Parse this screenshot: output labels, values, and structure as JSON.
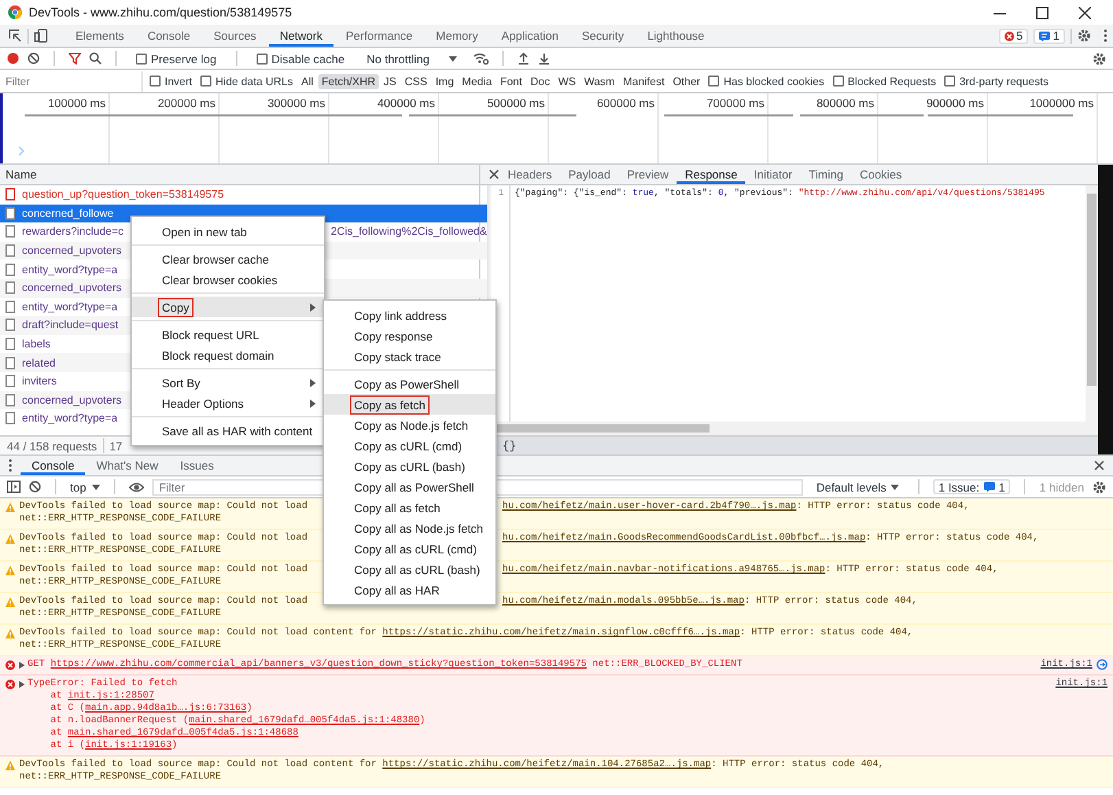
{
  "window": {
    "title": "DevTools - www.zhihu.com/question/538149575"
  },
  "panel_tabs": [
    {
      "label": "Elements",
      "selected": false
    },
    {
      "label": "Console",
      "selected": false
    },
    {
      "label": "Sources",
      "selected": false
    },
    {
      "label": "Network",
      "selected": true
    },
    {
      "label": "Performance",
      "selected": false
    },
    {
      "label": "Memory",
      "selected": false
    },
    {
      "label": "Application",
      "selected": false
    },
    {
      "label": "Security",
      "selected": false
    },
    {
      "label": "Lighthouse",
      "selected": false
    }
  ],
  "badges": {
    "errors": "5",
    "messages": "1"
  },
  "toolbar": {
    "recording": true,
    "preserve_log": {
      "label": "Preserve log",
      "checked": false
    },
    "disable_cache": {
      "label": "Disable cache",
      "checked": false
    },
    "throttling": "No throttling"
  },
  "filter_bar": {
    "placeholder": "Filter",
    "invert": {
      "label": "Invert",
      "checked": false
    },
    "hide_data_urls": {
      "label": "Hide data URLs",
      "checked": false
    },
    "types": [
      {
        "label": "All",
        "selected": false
      },
      {
        "label": "Fetch/XHR",
        "selected": true
      },
      {
        "label": "JS",
        "selected": false
      },
      {
        "label": "CSS",
        "selected": false
      },
      {
        "label": "Img",
        "selected": false
      },
      {
        "label": "Media",
        "selected": false
      },
      {
        "label": "Font",
        "selected": false
      },
      {
        "label": "Doc",
        "selected": false
      },
      {
        "label": "WS",
        "selected": false
      },
      {
        "label": "Wasm",
        "selected": false
      },
      {
        "label": "Manifest",
        "selected": false
      },
      {
        "label": "Other",
        "selected": false
      }
    ],
    "options": [
      {
        "label": "Has blocked cookies",
        "checked": false
      },
      {
        "label": "Blocked Requests",
        "checked": false
      },
      {
        "label": "3rd-party requests",
        "checked": false
      }
    ]
  },
  "timeline": {
    "ticks": [
      "100000 ms",
      "200000 ms",
      "300000 ms",
      "400000 ms",
      "500000 ms",
      "600000 ms",
      "700000 ms",
      "800000 ms",
      "900000 ms",
      "1000000 ms"
    ]
  },
  "requests": {
    "column": "Name",
    "rows": [
      {
        "name": "question_up?question_token=538149575",
        "failed": true,
        "selected": false
      },
      {
        "name": "concerned_followe",
        "failed": false,
        "selected": true
      },
      {
        "name": "rewarders?include=c",
        "tail": "2Cis_following%2Cis_followed&",
        "failed": false,
        "selected": false
      },
      {
        "name": "concerned_upvoters",
        "failed": false,
        "selected": false
      },
      {
        "name": "entity_word?type=a",
        "failed": false,
        "selected": false
      },
      {
        "name": "concerned_upvoters",
        "failed": false,
        "selected": false
      },
      {
        "name": "entity_word?type=a",
        "failed": false,
        "selected": false
      },
      {
        "name": "draft?include=quest",
        "failed": false,
        "selected": false
      },
      {
        "name": "labels",
        "failed": false,
        "selected": false
      },
      {
        "name": "related",
        "failed": false,
        "selected": false
      },
      {
        "name": "inviters",
        "failed": false,
        "selected": false
      },
      {
        "name": "concerned_upvoters",
        "failed": false,
        "selected": false
      },
      {
        "name": "entity_word?type=a",
        "failed": false,
        "selected": false
      }
    ],
    "status": [
      "44 / 158 requests",
      "17"
    ]
  },
  "detail": {
    "tabs": [
      {
        "label": "Headers",
        "selected": false
      },
      {
        "label": "Payload",
        "selected": false
      },
      {
        "label": "Preview",
        "selected": false
      },
      {
        "label": "Response",
        "selected": true
      },
      {
        "label": "Initiator",
        "selected": false
      },
      {
        "label": "Timing",
        "selected": false
      },
      {
        "label": "Cookies",
        "selected": false
      }
    ],
    "lines": [
      {
        "number": "1",
        "tokens": [
          {
            "kind": "punct",
            "text": "{"
          },
          {
            "kind": "key",
            "text": "\"paging\""
          },
          {
            "kind": "punct",
            "text": ": {"
          },
          {
            "kind": "key",
            "text": "\"is_end\""
          },
          {
            "kind": "punct",
            "text": ": "
          },
          {
            "kind": "keyword",
            "text": "true"
          },
          {
            "kind": "punct",
            "text": ", "
          },
          {
            "kind": "key",
            "text": "\"totals\""
          },
          {
            "kind": "punct",
            "text": ": "
          },
          {
            "kind": "number",
            "text": "0"
          },
          {
            "kind": "punct",
            "text": ", "
          },
          {
            "kind": "key",
            "text": "\"previous\""
          },
          {
            "kind": "punct",
            "text": ": "
          },
          {
            "kind": "string",
            "text": "\"http://www.zhihu.com/api/v4/questions/5381495"
          }
        ]
      }
    ],
    "footer": "{}"
  },
  "drawer": {
    "tabs": [
      {
        "label": "Console",
        "selected": true
      },
      {
        "label": "What's New",
        "selected": false
      },
      {
        "label": "Issues",
        "selected": false
      }
    ],
    "context": "top",
    "placeholder": "Filter",
    "levels": "Default levels",
    "issues": "1 Issue:",
    "issues_count": "1",
    "hidden": "1 hidden",
    "messages": [
      {
        "kind": "warning",
        "lines": [
          {
            "left": [
              {
                "kind": "text",
                "text": "DevTools failed to load source map: Could not load"
              }
            ],
            "right": [
              {
                "kind": "link",
                "text": "hu.com/heifetz/main.user-hover-card.2b4f790….js.map"
              },
              {
                "kind": "text",
                "text": ": HTTP error: status code 404,"
              }
            ]
          },
          {
            "left": [
              {
                "kind": "text",
                "text": "net::ERR_HTTP_RESPONSE_CODE_FAILURE"
              }
            ]
          }
        ]
      },
      {
        "kind": "warning",
        "lines": [
          {
            "left": [
              {
                "kind": "text",
                "text": "DevTools failed to load source map: Could not load"
              }
            ],
            "right": [
              {
                "kind": "link",
                "text": "hu.com/heifetz/main.GoodsRecommendGoodsCardList.00bfbcf….js.map"
              },
              {
                "kind": "text",
                "text": ": HTTP error: status code 404,"
              }
            ]
          },
          {
            "left": [
              {
                "kind": "text",
                "text": "net::ERR_HTTP_RESPONSE_CODE_FAILURE"
              }
            ]
          }
        ]
      },
      {
        "kind": "warning",
        "lines": [
          {
            "left": [
              {
                "kind": "text",
                "text": "DevTools failed to load source map: Could not load"
              }
            ],
            "right": [
              {
                "kind": "link",
                "text": "hu.com/heifetz/main.navbar-notifications.a948765….js.map"
              },
              {
                "kind": "text",
                "text": ": HTTP error: status code 404,"
              }
            ]
          },
          {
            "left": [
              {
                "kind": "text",
                "text": "net::ERR_HTTP_RESPONSE_CODE_FAILURE"
              }
            ]
          }
        ]
      },
      {
        "kind": "warning",
        "lines": [
          {
            "left": [
              {
                "kind": "text",
                "text": "DevTools failed to load source map: Could not load"
              }
            ],
            "right": [
              {
                "kind": "link",
                "text": "hu.com/heifetz/main.modals.095bb5e….js.map"
              },
              {
                "kind": "text",
                "text": ": HTTP error: status code 404,"
              }
            ]
          },
          {
            "left": [
              {
                "kind": "text",
                "text": "net::ERR_HTTP_RESPONSE_CODE_FAILURE"
              }
            ]
          }
        ]
      },
      {
        "kind": "warning",
        "lines": [
          {
            "left": [
              {
                "kind": "text",
                "text": "DevTools failed to load source map: Could not load content for "
              },
              {
                "kind": "link",
                "text": "https://static.zhihu.com/heifetz/main.signflow.c0cfff6….js.map"
              },
              {
                "kind": "text",
                "text": ": HTTP error: status code 404,"
              }
            ]
          },
          {
            "left": [
              {
                "kind": "text",
                "text": "net::ERR_HTTP_RESPONSE_CODE_FAILURE"
              }
            ]
          }
        ]
      },
      {
        "kind": "error",
        "expandable": true,
        "source": "init.js:1",
        "lines": [
          {
            "left": [
              {
                "kind": "text",
                "text": "GET "
              },
              {
                "kind": "link",
                "text": "https://www.zhihu.com/commercial_api/banners_v3/question_down_sticky?question_token=538149575"
              },
              {
                "kind": "text",
                "text": " net::ERR_BLOCKED_BY_CLIENT"
              }
            ]
          }
        ]
      },
      {
        "kind": "error",
        "expandable": true,
        "source": "init.js:1",
        "lines": [
          {
            "left": [
              {
                "kind": "text",
                "text": "TypeError: Failed to fetch"
              }
            ]
          },
          {
            "left": [
              {
                "kind": "text",
                "text": "    at "
              },
              {
                "kind": "link",
                "text": "init.js:1:28507"
              }
            ]
          },
          {
            "left": [
              {
                "kind": "text",
                "text": "    at C ("
              },
              {
                "kind": "link",
                "text": "main.app.94d8a1b….js:6:73163"
              },
              {
                "kind": "text",
                "text": ")"
              }
            ]
          },
          {
            "left": [
              {
                "kind": "text",
                "text": "    at n.loadBannerRequest ("
              },
              {
                "kind": "link",
                "text": "main.shared_1679dafd…005f4da5.js:1:48380"
              },
              {
                "kind": "text",
                "text": ")"
              }
            ]
          },
          {
            "left": [
              {
                "kind": "text",
                "text": "    at "
              },
              {
                "kind": "link",
                "text": "main.shared_1679dafd…005f4da5.js:1:48688"
              }
            ]
          },
          {
            "left": [
              {
                "kind": "text",
                "text": "    at i ("
              },
              {
                "kind": "link",
                "text": "init.js:1:19163"
              },
              {
                "kind": "text",
                "text": ")"
              }
            ]
          }
        ]
      },
      {
        "kind": "warning",
        "lines": [
          {
            "left": [
              {
                "kind": "text",
                "text": "DevTools failed to load source map: Could not load content for "
              },
              {
                "kind": "link",
                "text": "https://static.zhihu.com/heifetz/main.104.27685a2….js.map"
              },
              {
                "kind": "text",
                "text": ": HTTP error: status code 404,"
              }
            ]
          },
          {
            "left": [
              {
                "kind": "text",
                "text": "net::ERR_HTTP_RESPONSE_CODE_FAILURE"
              }
            ]
          }
        ]
      }
    ]
  },
  "context_menu": {
    "items": [
      {
        "kind": "item",
        "label": "Open in new tab",
        "submenu": false,
        "highlighted": false,
        "boxed": false
      },
      {
        "kind": "separator"
      },
      {
        "kind": "item",
        "label": "Clear browser cache",
        "submenu": false,
        "highlighted": false,
        "boxed": false
      },
      {
        "kind": "item",
        "label": "Clear browser cookies",
        "submenu": false,
        "highlighted": false,
        "boxed": false
      },
      {
        "kind": "separator"
      },
      {
        "kind": "item",
        "label": "Copy",
        "submenu": true,
        "highlighted": true,
        "boxed": true
      },
      {
        "kind": "separator"
      },
      {
        "kind": "item",
        "label": "Block request URL",
        "submenu": false,
        "highlighted": false,
        "boxed": false
      },
      {
        "kind": "item",
        "label": "Block request domain",
        "submenu": false,
        "highlighted": false,
        "boxed": false
      },
      {
        "kind": "separator"
      },
      {
        "kind": "item",
        "label": "Sort By",
        "submenu": true,
        "highlighted": false,
        "boxed": false
      },
      {
        "kind": "item",
        "label": "Header Options",
        "submenu": true,
        "highlighted": false,
        "boxed": false
      },
      {
        "kind": "separator"
      },
      {
        "kind": "item",
        "label": "Save all as HAR with content",
        "submenu": false,
        "highlighted": false,
        "boxed": false
      }
    ]
  },
  "submenu": {
    "items": [
      {
        "kind": "item",
        "label": "Copy link address",
        "submenu": false,
        "highlighted": false,
        "boxed": false
      },
      {
        "kind": "item",
        "label": "Copy response",
        "submenu": false,
        "highlighted": false,
        "boxed": false
      },
      {
        "kind": "item",
        "label": "Copy stack trace",
        "submenu": false,
        "highlighted": false,
        "boxed": false
      },
      {
        "kind": "separator"
      },
      {
        "kind": "item",
        "label": "Copy as PowerShell",
        "submenu": false,
        "highlighted": false,
        "boxed": false
      },
      {
        "kind": "item",
        "label": "Copy as fetch",
        "submenu": false,
        "highlighted": true,
        "boxed": true
      },
      {
        "kind": "item",
        "label": "Copy as Node.js fetch",
        "submenu": false,
        "highlighted": false,
        "boxed": false
      },
      {
        "kind": "item",
        "label": "Copy as cURL (cmd)",
        "submenu": false,
        "highlighted": false,
        "boxed": false
      },
      {
        "kind": "item",
        "label": "Copy as cURL (bash)",
        "submenu": false,
        "highlighted": false,
        "boxed": false
      },
      {
        "kind": "item",
        "label": "Copy all as PowerShell",
        "submenu": false,
        "highlighted": false,
        "boxed": false
      },
      {
        "kind": "item",
        "label": "Copy all as fetch",
        "submenu": false,
        "highlighted": false,
        "boxed": false
      },
      {
        "kind": "item",
        "label": "Copy all as Node.js fetch",
        "submenu": false,
        "highlighted": false,
        "boxed": false
      },
      {
        "kind": "item",
        "label": "Copy all as cURL (cmd)",
        "submenu": false,
        "highlighted": false,
        "boxed": false
      },
      {
        "kind": "item",
        "label": "Copy all as cURL (bash)",
        "submenu": false,
        "highlighted": false,
        "boxed": false
      },
      {
        "kind": "item",
        "label": "Copy all as HAR",
        "submenu": false,
        "highlighted": false,
        "boxed": false
      }
    ]
  }
}
